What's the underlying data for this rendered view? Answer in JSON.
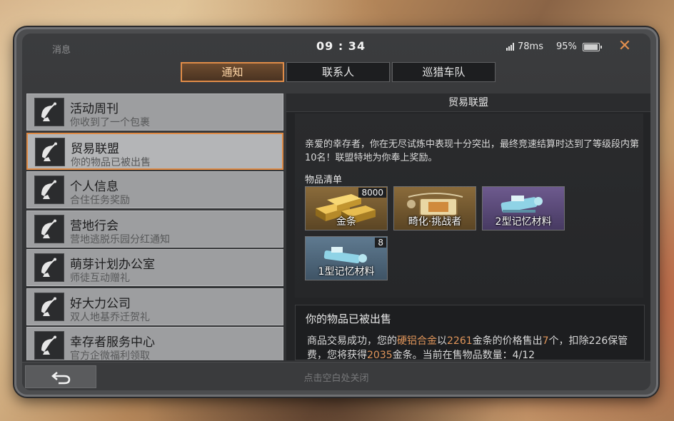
{
  "status": {
    "message_label": "消息",
    "time": "09 : 34",
    "ping": "78ms",
    "battery": "95%",
    "battery_level": 0.95
  },
  "tabs": [
    {
      "label": "通知",
      "active": true
    },
    {
      "label": "联系人",
      "active": false
    },
    {
      "label": "巡猎车队",
      "active": false
    }
  ],
  "messages": [
    {
      "title": "活动周刊",
      "subtitle": "你收到了一个包裹",
      "icon": "satellite-dish-icon"
    },
    {
      "title": "贸易联盟",
      "subtitle": "你的物品已被出售",
      "icon": "satellite-dish-icon",
      "active": true
    },
    {
      "title": "个人信息",
      "subtitle": "合住任务奖励",
      "icon": "satellite-dish-icon"
    },
    {
      "title": "营地行会",
      "subtitle": "营地逃脱乐园分红通知",
      "icon": "satellite-dish-icon"
    },
    {
      "title": "萌芽计划办公室",
      "subtitle": "师徒互动赠礼",
      "icon": "satellite-dish-icon"
    },
    {
      "title": "好大力公司",
      "subtitle": "双人地基乔迁贺礼",
      "icon": "satellite-dish-icon"
    },
    {
      "title": "幸存者服务中心",
      "subtitle": "官方企微福利领取",
      "icon": "satellite-dish-icon"
    }
  ],
  "detail": {
    "header": "贸易联盟",
    "body": "亲爱的幸存者，你在无尽试炼中表现十分突出，最终竞速结算时达到了等级段内第10名！联盟特地为你奉上奖励。",
    "items_label": "物品清单",
    "items": [
      {
        "name": "金条",
        "count": "8000",
        "icon": "gold-bars-icon",
        "rarity_color": "#8a6b3b"
      },
      {
        "name": "畸化·挑战者",
        "count": "",
        "icon": "nameplate-badge-icon",
        "rarity_color": "#8a6b3b"
      },
      {
        "name": "2型记忆材料",
        "count": "",
        "icon": "memory-material-icon",
        "rarity_color": "#6d5a8e"
      },
      {
        "name": "1型记忆材料",
        "count": "8",
        "icon": "memory-material-icon",
        "rarity_color": "#5f7a90"
      }
    ],
    "sold_card": {
      "title": "你的物品已被出售",
      "line1_prefix": "商品交易成功，您的",
      "item": "硬铝合金",
      "line1_mid": "以",
      "price": "2261",
      "line1_mid2": "金条的价格售出",
      "qty": "7",
      "line1_suffix": "个，扣",
      "line2_prefix": "除226保管费，您将获得",
      "earned": "2035",
      "line2_suffix": "金条。当前在售物品数量：4/12"
    }
  },
  "bottom": {
    "hint": "点击空白处关闭"
  },
  "colors": {
    "accent": "#e08c48",
    "highlight": "#e0955a"
  }
}
